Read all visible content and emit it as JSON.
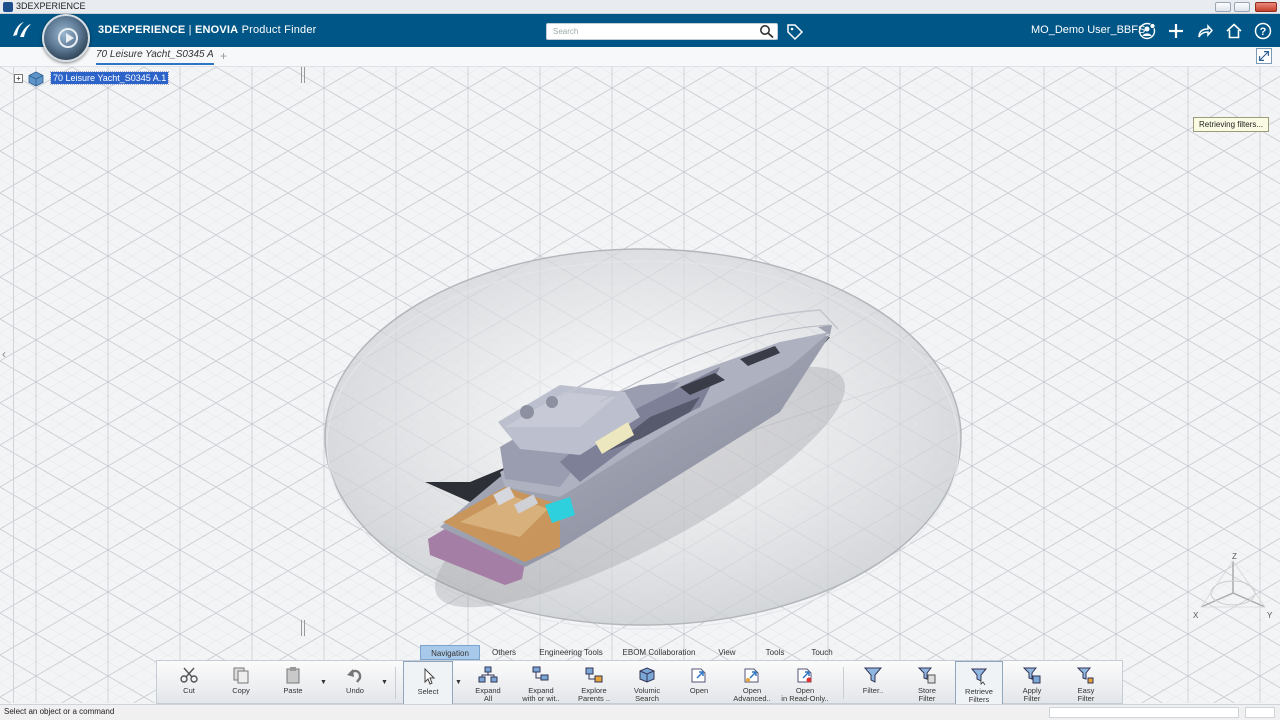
{
  "window": {
    "title": "3DEXPERIENCE"
  },
  "header": {
    "brand_bold": "3DEXPERIENCE",
    "brand_sep": " | ",
    "brand_app_bold": "ENOVIA",
    "brand_app": " Product Finder",
    "search_placeholder": "Search",
    "user": "MO_Demo User_BBFS"
  },
  "tabs": {
    "document_tab": "70 Leisure Yacht_S0345 A.1",
    "add": "+"
  },
  "tree": {
    "expand": "+",
    "root_label": "70 Leisure Yacht_S0345 A.1"
  },
  "tooltip": "Retrieving filters...",
  "axis": {
    "z": "Z",
    "x": "X",
    "y": "Y"
  },
  "command_tabs": [
    {
      "label": "Navigation",
      "active": true
    },
    {
      "label": "Others"
    },
    {
      "label": "Engineering Tools"
    },
    {
      "label": "EBOM Collaboration"
    },
    {
      "label": "View"
    },
    {
      "label": "Tools"
    },
    {
      "label": "Touch"
    }
  ],
  "actions": {
    "cut": "Cut",
    "copy": "Copy",
    "paste": "Paste",
    "undo": "Undo",
    "select": "Select",
    "expand_all_1": "Expand",
    "expand_all_2": "All",
    "expand_with_1": "Expand",
    "expand_with_2": "with or wit..",
    "explore_1": "Explore",
    "explore_2": "Parents ..",
    "volumic_1": "Volumic",
    "volumic_2": "Search",
    "open": "Open",
    "open_adv_1": "Open",
    "open_adv_2": "Advanced..",
    "open_ro_1": "Open",
    "open_ro_2": "in Read-Only..",
    "filter": "Filter..",
    "store_1": "Store",
    "store_2": "Filter",
    "retrieve_1": "Retrieve",
    "retrieve_2": "Filters",
    "apply_1": "Apply",
    "apply_2": "Filter",
    "easy_1": "Easy",
    "easy_2": "Filter"
  },
  "status": {
    "message": "Select an object or a command"
  },
  "colors": {
    "header": "#005686",
    "selection": "#2c63c9",
    "active_tab": "#a9c9ea"
  }
}
